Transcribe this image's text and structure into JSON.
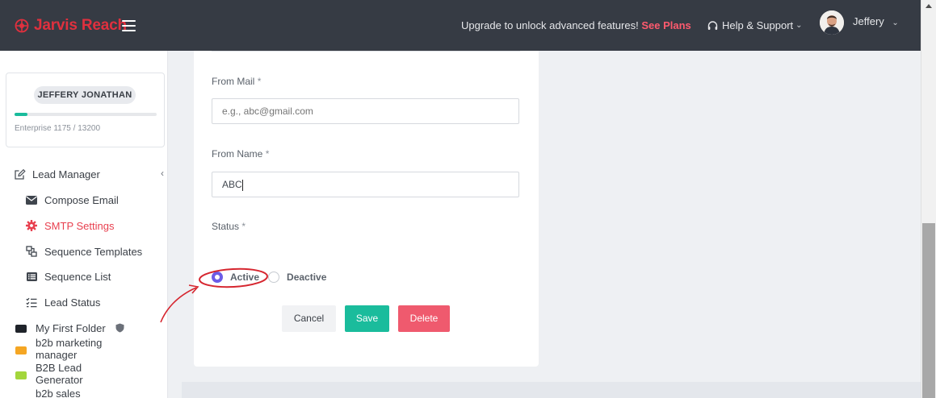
{
  "header": {
    "brand": "Jarvis Reach",
    "upgrade_text": "Upgrade to unlock advanced features!",
    "see_plans": "See Plans",
    "help": "Help & Support",
    "user": "Jeffery"
  },
  "profile": {
    "name": "JEFFERY JONATHAN",
    "plan": "Enterprise 1175 / 13200",
    "usage_fraction": 0.089
  },
  "sidebar": {
    "section": "Lead Manager",
    "items": [
      {
        "label": "Compose Email",
        "icon": "envelope-icon"
      },
      {
        "label": "SMTP Settings",
        "icon": "gear-icon",
        "active": true
      },
      {
        "label": "Sequence Templates",
        "icon": "sequence-icon"
      },
      {
        "label": "Sequence List",
        "icon": "list-icon"
      },
      {
        "label": "Lead Status",
        "icon": "checklist-icon"
      }
    ],
    "folders": [
      {
        "label": "My First Folder",
        "color": "#1f232a"
      },
      {
        "label": "b2b marketing manager",
        "color": "#f5a623"
      },
      {
        "label": "B2B Lead Generator",
        "color": "#a3d63c"
      },
      {
        "label": "b2b sales",
        "color": "#a3d63c"
      }
    ]
  },
  "form": {
    "from_mail_label": "From Mail",
    "from_mail_placeholder": "e.g., abc@gmail.com",
    "from_name_label": "From Name",
    "from_name_value": "ABC",
    "status_label": "Status",
    "required_mark": "*",
    "status_options": [
      {
        "label": "Active",
        "selected": true
      },
      {
        "label": "Deactive",
        "selected": false
      }
    ],
    "cancel": "Cancel",
    "save": "Save",
    "delete": "Delete"
  },
  "colors": {
    "accent_green": "#1abc9c",
    "accent_red": "#ef5a6e",
    "radio_purple": "#6c5ce7",
    "topbar": "#363b44"
  }
}
